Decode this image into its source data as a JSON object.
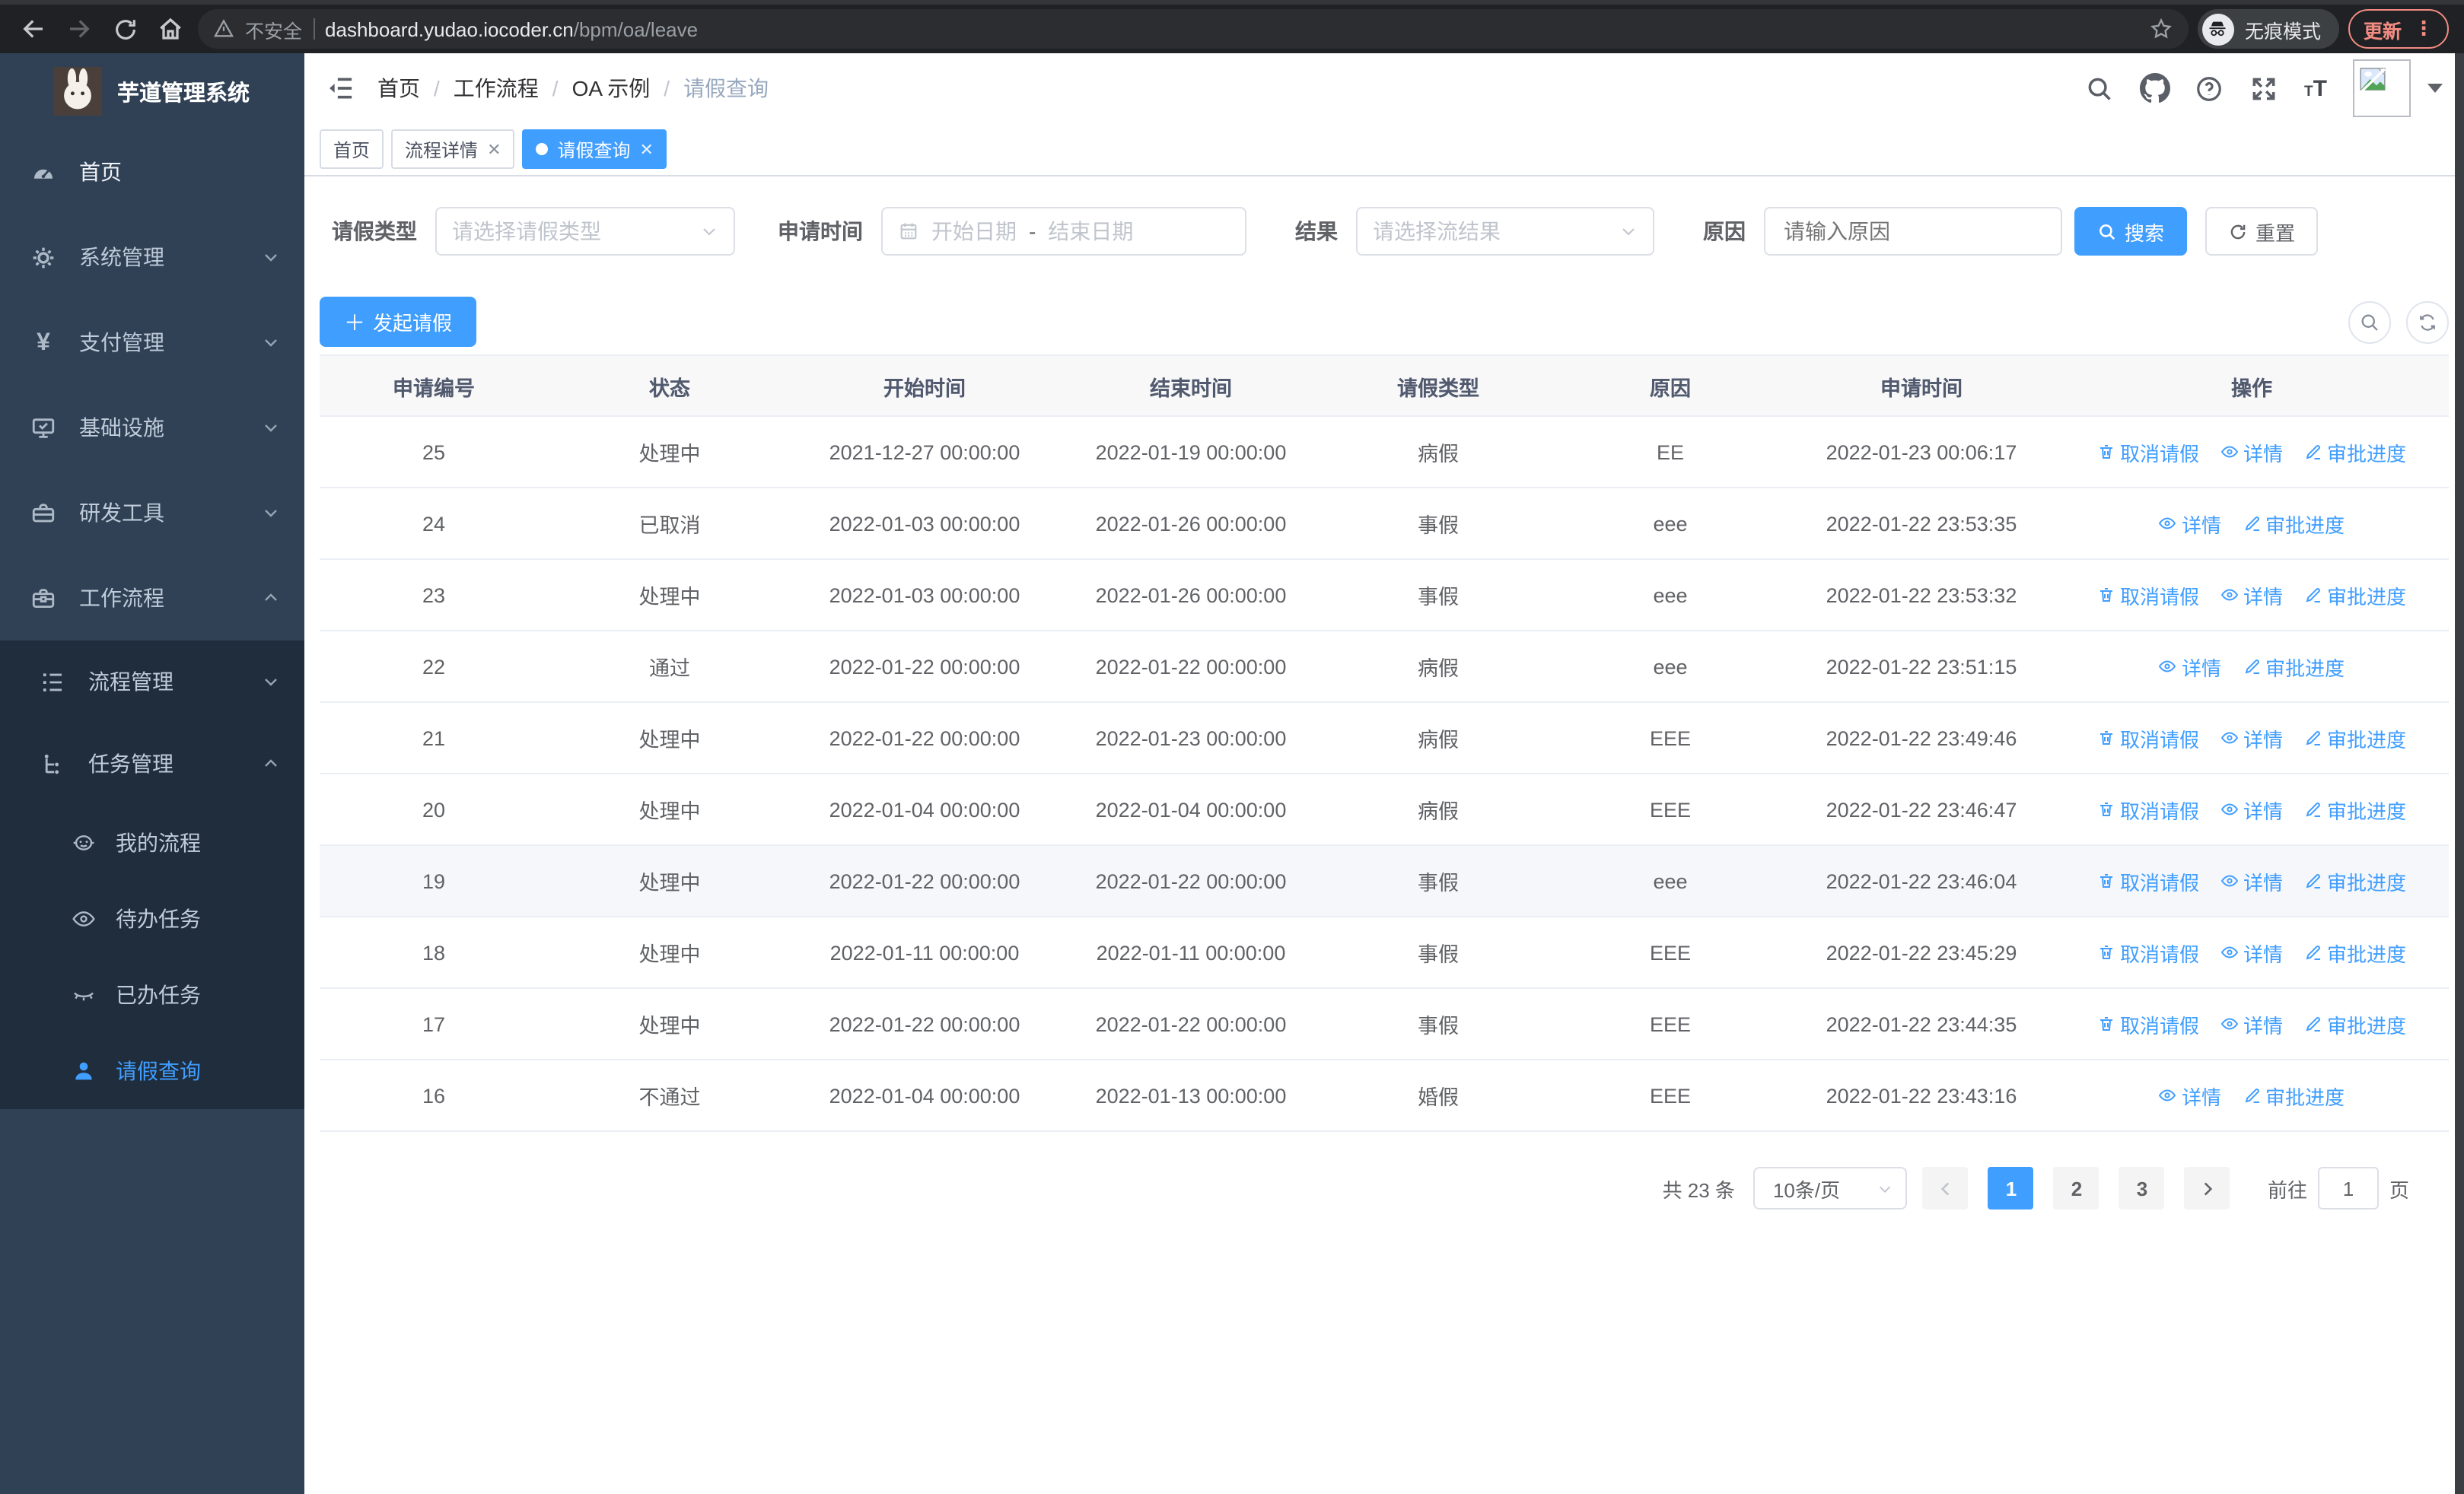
{
  "browser": {
    "security_label": "不安全",
    "url_host": "dashboard.yudao.iocoder.cn",
    "url_path": "/bpm/oa/leave",
    "incognito_label": "无痕模式",
    "update_label": "更新"
  },
  "sidebar": {
    "logo_title": "芋道管理系统",
    "items": [
      {
        "label": "首页"
      },
      {
        "label": "系统管理"
      },
      {
        "label": "支付管理"
      },
      {
        "label": "基础设施"
      },
      {
        "label": "研发工具"
      },
      {
        "label": "工作流程"
      }
    ],
    "process_group": {
      "label": "流程管理"
    },
    "task_group": {
      "label": "任务管理"
    },
    "task_items": [
      {
        "label": "我的流程"
      },
      {
        "label": "待办任务"
      },
      {
        "label": "已办任务"
      },
      {
        "label": "请假查询"
      }
    ]
  },
  "header": {
    "breadcrumb": [
      "首页",
      "工作流程",
      "OA 示例",
      "请假查询"
    ]
  },
  "tabs": [
    {
      "label": "首页"
    },
    {
      "label": "流程详情"
    },
    {
      "label": "请假查询"
    }
  ],
  "filters": {
    "leave_type_label": "请假类型",
    "leave_type_placeholder": "请选择请假类型",
    "apply_time_label": "申请时间",
    "start_date_placeholder": "开始日期",
    "range_separator": "-",
    "end_date_placeholder": "结束日期",
    "result_label": "结果",
    "result_placeholder": "请选择流结果",
    "reason_label": "原因",
    "reason_placeholder": "请输入原因",
    "search_button": "搜索",
    "reset_button": "重置"
  },
  "toolbar": {
    "create_button": "发起请假"
  },
  "table": {
    "headers": [
      "申请编号",
      "状态",
      "开始时间",
      "结束时间",
      "请假类型",
      "原因",
      "申请时间",
      "操作"
    ],
    "action_defs": {
      "cancel": {
        "label": "取消请假",
        "icon": "delete-icon"
      },
      "detail": {
        "label": "详情",
        "icon": "view-icon"
      },
      "progress": {
        "label": "审批进度",
        "icon": "edit-icon"
      }
    },
    "rows": [
      {
        "id": "25",
        "status": "处理中",
        "start": "2021-12-27 00:00:00",
        "end": "2022-01-19 00:00:00",
        "type": "病假",
        "reason": "EE",
        "apply": "2022-01-23 00:06:17",
        "actions": [
          "cancel",
          "detail",
          "progress"
        ],
        "highlighted": false
      },
      {
        "id": "24",
        "status": "已取消",
        "start": "2022-01-03 00:00:00",
        "end": "2022-01-26 00:00:00",
        "type": "事假",
        "reason": "eee",
        "apply": "2022-01-22 23:53:35",
        "actions": [
          "detail",
          "progress"
        ],
        "highlighted": false
      },
      {
        "id": "23",
        "status": "处理中",
        "start": "2022-01-03 00:00:00",
        "end": "2022-01-26 00:00:00",
        "type": "事假",
        "reason": "eee",
        "apply": "2022-01-22 23:53:32",
        "actions": [
          "cancel",
          "detail",
          "progress"
        ],
        "highlighted": false
      },
      {
        "id": "22",
        "status": "通过",
        "start": "2022-01-22 00:00:00",
        "end": "2022-01-22 00:00:00",
        "type": "病假",
        "reason": "eee",
        "apply": "2022-01-22 23:51:15",
        "actions": [
          "detail",
          "progress"
        ],
        "highlighted": false
      },
      {
        "id": "21",
        "status": "处理中",
        "start": "2022-01-22 00:00:00",
        "end": "2022-01-23 00:00:00",
        "type": "病假",
        "reason": "EEE",
        "apply": "2022-01-22 23:49:46",
        "actions": [
          "cancel",
          "detail",
          "progress"
        ],
        "highlighted": false
      },
      {
        "id": "20",
        "status": "处理中",
        "start": "2022-01-04 00:00:00",
        "end": "2022-01-04 00:00:00",
        "type": "病假",
        "reason": "EEE",
        "apply": "2022-01-22 23:46:47",
        "actions": [
          "cancel",
          "detail",
          "progress"
        ],
        "highlighted": false
      },
      {
        "id": "19",
        "status": "处理中",
        "start": "2022-01-22 00:00:00",
        "end": "2022-01-22 00:00:00",
        "type": "事假",
        "reason": "eee",
        "apply": "2022-01-22 23:46:04",
        "actions": [
          "cancel",
          "detail",
          "progress"
        ],
        "highlighted": true
      },
      {
        "id": "18",
        "status": "处理中",
        "start": "2022-01-11 00:00:00",
        "end": "2022-01-11 00:00:00",
        "type": "事假",
        "reason": "EEE",
        "apply": "2022-01-22 23:45:29",
        "actions": [
          "cancel",
          "detail",
          "progress"
        ],
        "highlighted": false
      },
      {
        "id": "17",
        "status": "处理中",
        "start": "2022-01-22 00:00:00",
        "end": "2022-01-22 00:00:00",
        "type": "事假",
        "reason": "EEE",
        "apply": "2022-01-22 23:44:35",
        "actions": [
          "cancel",
          "detail",
          "progress"
        ],
        "highlighted": false
      },
      {
        "id": "16",
        "status": "不通过",
        "start": "2022-01-04 00:00:00",
        "end": "2022-01-13 00:00:00",
        "type": "婚假",
        "reason": "EEE",
        "apply": "2022-01-22 23:43:16",
        "actions": [
          "detail",
          "progress"
        ],
        "highlighted": false
      }
    ]
  },
  "pagination": {
    "total": "共 23 条",
    "page_size": "10条/页",
    "pages": [
      "1",
      "2",
      "3"
    ],
    "active_page": "1",
    "goto_label": "前往",
    "goto_value": "1",
    "goto_suffix": "页"
  }
}
